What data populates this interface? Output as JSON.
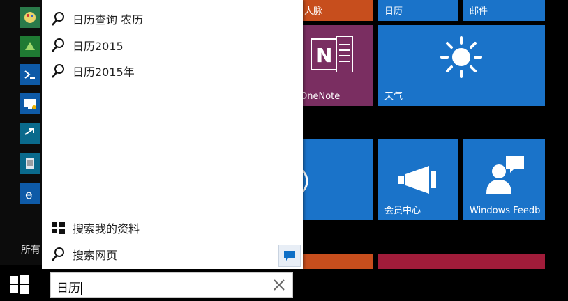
{
  "search_panel": {
    "suggestions": [
      {
        "label": "日历查询 农历"
      },
      {
        "label": "日历2015"
      },
      {
        "label": "日历2015年"
      }
    ],
    "my_stuff_label": "搜索我的资料",
    "web_label": "搜索网页"
  },
  "search_box": {
    "value": "日历"
  },
  "left_column": {
    "all_apps_label": "所有"
  },
  "tiles": {
    "people": "人脉",
    "calendar": "日历",
    "mail": "邮件",
    "onenote": "OneNote",
    "weather": "天气",
    "member_center": "会员中心",
    "windows_feedback": "Windows Feedb"
  },
  "colors": {
    "accent": "#0f6fc6",
    "tile_blue": "#1a73c9",
    "tile_purple": "#7a2e61",
    "tile_orange": "#c74e1d",
    "tile_red": "#a11c3a"
  },
  "icons": {
    "search": "search-icon",
    "windows": "windows-logo-icon",
    "clear": "close-icon",
    "feedback": "feedback-icon"
  }
}
